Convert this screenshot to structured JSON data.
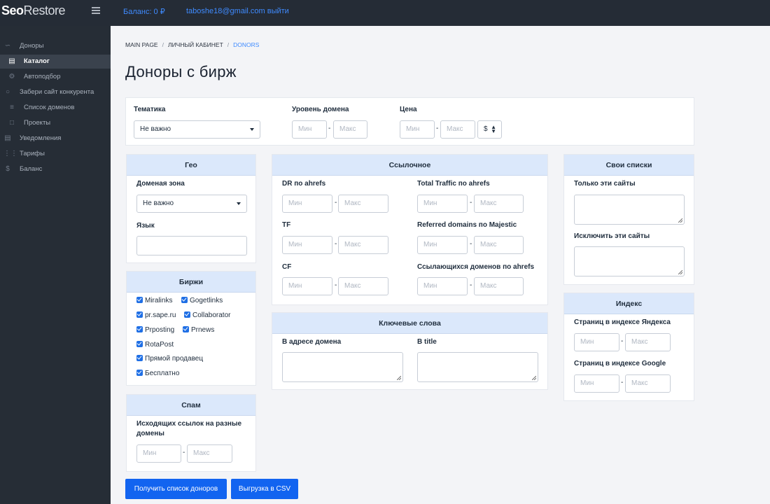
{
  "header": {
    "logo_bold": "Seo",
    "logo_light": "Restore",
    "balance": "Баланс: 0 ₽",
    "user": "taboshe18@gmail.com выйти"
  },
  "sidebar": {
    "items": [
      {
        "label": "Доноры",
        "icon": "share-icon"
      },
      {
        "label": "Каталог",
        "icon": "document-icon",
        "active": true
      },
      {
        "label": "Автоподбор",
        "icon": "gear-icon"
      },
      {
        "label": "Забери сайт конкурента",
        "icon": "target-icon"
      },
      {
        "label": "Список доменов",
        "icon": "list-icon"
      },
      {
        "label": "Проекты",
        "icon": "folder-icon"
      },
      {
        "label": "Уведомления",
        "icon": "inbox-icon"
      },
      {
        "label": "Тарифы",
        "icon": "sliders-icon"
      },
      {
        "label": "Баланс",
        "icon": "dollar-icon"
      }
    ]
  },
  "breadcrumb": [
    "MAIN PAGE",
    "ЛИЧНЫЙ КАБИНЕТ",
    "DONORS"
  ],
  "page_title": "Доноры с бирж",
  "placeholders": {
    "min": "Мин",
    "max": "Макс"
  },
  "filters": {
    "topic_label": "Тематика",
    "topic_value": "Не важно",
    "domain_level_label": "Уровень домена",
    "price_label": "Цена",
    "currency": "$"
  },
  "geo": {
    "title": "Гео",
    "zone_label": "Доменая зона",
    "zone_value": "Не важно",
    "lang_label": "Язык"
  },
  "exchanges": {
    "title": "Биржи",
    "items": [
      "Miralinks",
      "Gogetlinks",
      "pr.sape.ru",
      "Collaborator",
      "Prposting",
      "Prnews",
      "RotaPost",
      "Прямой продавец",
      "Бесплатно"
    ]
  },
  "spam": {
    "title": "Спам",
    "label_line1": "Исходящих ссылок на разные",
    "label_line2": "домены"
  },
  "links": {
    "title": "Ссылочное",
    "dr": "DR по ahrefs",
    "traffic": "Total Traffic по ahrefs",
    "tf": "TF",
    "referred": "Referred domains по Majestic",
    "cf": "CF",
    "linking": "Ссылающихся доменов по ahrefs"
  },
  "keywords": {
    "title": "Ключевые слова",
    "domain_label": "В адресе домена",
    "title_label": "В title"
  },
  "own_lists": {
    "title": "Свои списки",
    "only_label": "Только эти сайты",
    "exclude_label": "Исключить эти сайты"
  },
  "index": {
    "title": "Индекс",
    "yandex_label": "Страниц в индексе Яндекса",
    "google_label": "Страниц в индексе Google"
  },
  "buttons": {
    "get_list": "Получить список доноров",
    "export_csv": "Выгрузка в CSV"
  },
  "colors": {
    "topbar": "#252c36",
    "sidebar": "#262d36",
    "card_head": "#dbe8fb",
    "primary": "#1264f0",
    "link": "#3f8bff"
  }
}
